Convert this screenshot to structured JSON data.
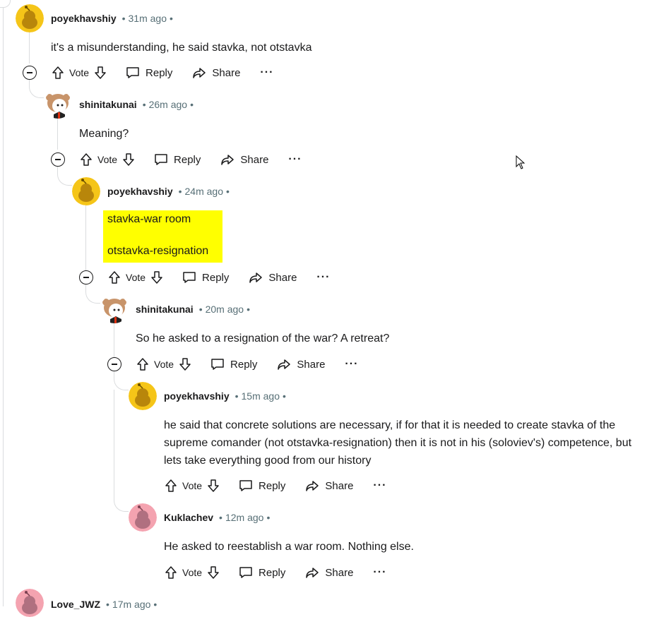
{
  "actions": {
    "vote": "Vote",
    "reply": "Reply",
    "share": "Share",
    "more": "···"
  },
  "comments": [
    {
      "author": "poyekhavshiy",
      "time": "31m ago",
      "body": [
        "it's a misunderstanding, he said stavka, not otstavka"
      ],
      "avatar": "yellow-snoo"
    },
    {
      "author": "shinitakunai",
      "time": "26m ago",
      "body": [
        "Meaning?"
      ],
      "avatar": "anime-girl"
    },
    {
      "author": "poyekhavshiy",
      "time": "24m ago",
      "body": [
        "stavka-war room",
        "otstavka-resignation"
      ],
      "avatar": "yellow-snoo",
      "highlighted": true
    },
    {
      "author": "shinitakunai",
      "time": "20m ago",
      "body": [
        "So he asked to a resignation of the war? A retreat?"
      ],
      "avatar": "anime-girl"
    },
    {
      "author": "poyekhavshiy",
      "time": "15m ago",
      "body": [
        "he said that concrete solutions are necessary, if for that it is needed to create stavka of the supreme comander (not otstavka-resignation) then it is not in his (soloviev's) competence, but lets take everything good from our history"
      ],
      "avatar": "yellow-snoo"
    },
    {
      "author": "Kuklachev",
      "time": "12m ago",
      "body": [
        "He asked to reestablish a war room. Nothing else."
      ],
      "avatar": "pink-snoo"
    },
    {
      "author": "Love_JWZ",
      "time": "17m ago",
      "body": [],
      "avatar": "pink-snoo"
    }
  ],
  "colors": {
    "highlight": "#ffff00",
    "meta": "#576f76",
    "thread": "#dadcde",
    "yellow_avatar": "#f5c518",
    "pink_avatar": "#f4a3b0"
  }
}
